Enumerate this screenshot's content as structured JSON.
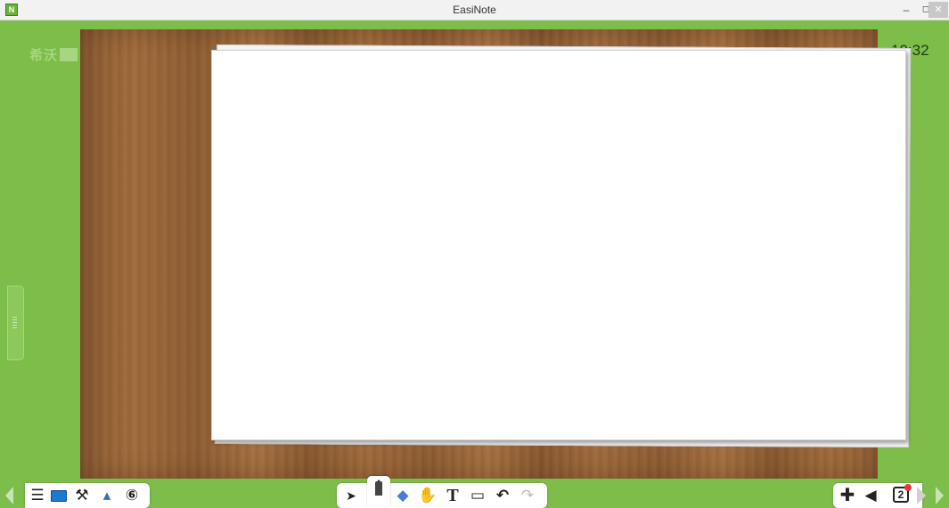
{
  "window": {
    "title": "EasiNote",
    "app_icon_glyph": "N",
    "minimize_glyph": "–",
    "restore_glyph": "◻",
    "close_glyph": "✕"
  },
  "brand": {
    "text": "希沃"
  },
  "clock": {
    "time": "10:32"
  },
  "toolbar_left": {
    "items": [
      {
        "name": "menu-icon",
        "glyph": "☰"
      },
      {
        "name": "desktop-icon",
        "glyph": ""
      },
      {
        "name": "tools-icon",
        "glyph": "⚒"
      },
      {
        "name": "media-icon",
        "glyph": "▴"
      },
      {
        "name": "cloud-class-icon",
        "glyph": "⑥"
      }
    ]
  },
  "toolbar_center": {
    "items": [
      {
        "name": "select-pointer-icon",
        "glyph": "➤"
      },
      {
        "name": "pen-icon",
        "glyph": ""
      },
      {
        "name": "eraser-icon",
        "glyph": "◆"
      },
      {
        "name": "roam-hand-icon",
        "glyph": "✋"
      },
      {
        "name": "text-icon",
        "glyph": "T"
      },
      {
        "name": "insert-icon",
        "glyph": "▭"
      },
      {
        "name": "undo-icon",
        "glyph": "↶"
      },
      {
        "name": "redo-icon",
        "glyph": "↷"
      }
    ]
  },
  "toolbar_right": {
    "add_glyph": "✚",
    "prev_glyph": "◀",
    "page_number": "2"
  },
  "colors": {
    "background": "#7dbd4a",
    "toolbar": "#ffffff",
    "wood": "#9a6537"
  }
}
